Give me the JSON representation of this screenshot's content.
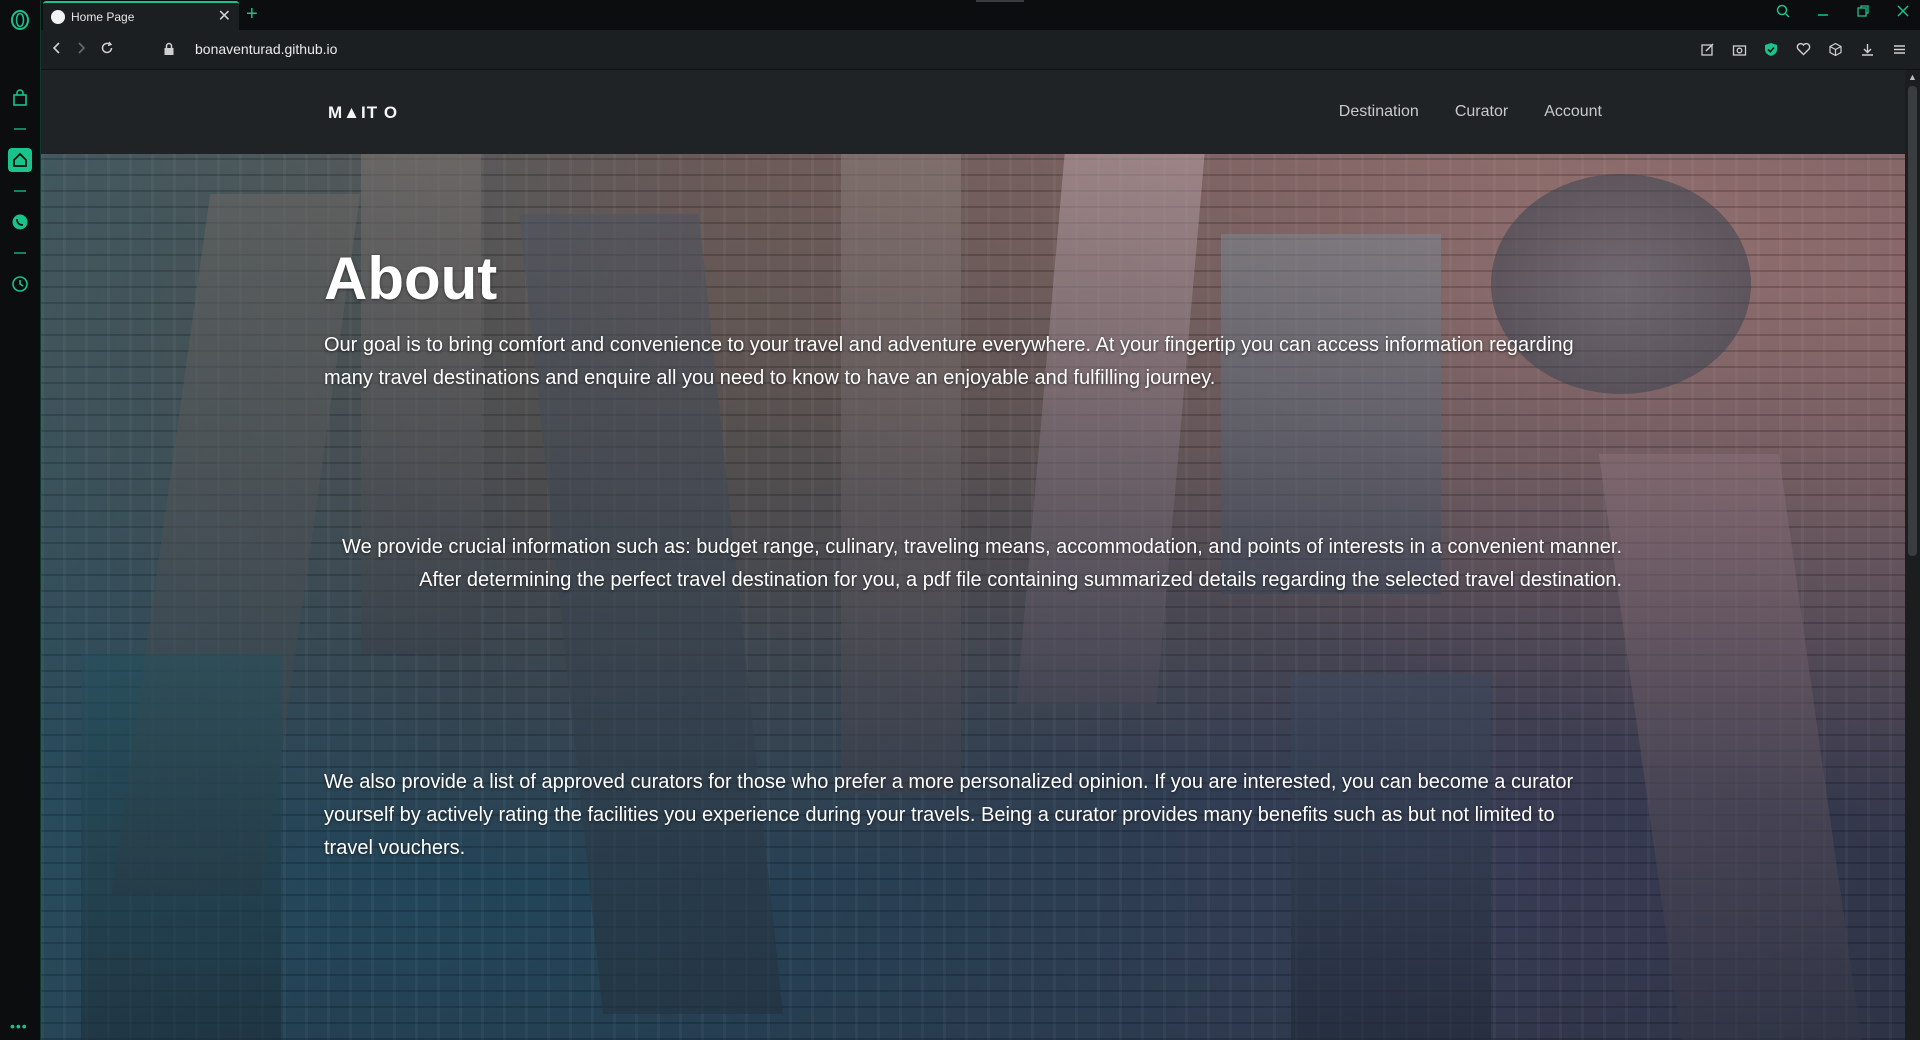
{
  "browser": {
    "tab": {
      "title": "Home Page",
      "close_symbol": "✕"
    },
    "new_tab_symbol": "+",
    "url": "bonaventurad.github.io",
    "accent_color": "#19c38a"
  },
  "site": {
    "logo": "M▲IT O",
    "nav": [
      "Destination",
      "Curator",
      "Account"
    ]
  },
  "about": {
    "title": "About",
    "paragraph1": "Our goal is to bring comfort and convenience to your travel and adventure everywhere. At your fingertip you can access information regarding many travel destinations and enquire all you need to know to have an enjoyable and fulfilling journey.",
    "paragraph2": "We provide crucial information such as: budget range, culinary, traveling means, accommodation, and points of interests in a convenient manner. After determining the perfect travel destination for you, a pdf file containing summarized details regarding the selected travel destination.",
    "paragraph3": "We also provide a list of approved curators for those who prefer a more personalized opinion. If you are interested, you can become a curator yourself by actively rating the facilities you experience during your travels. Being a curator provides many benefits such as but not limited to travel vouchers."
  },
  "icons": {
    "sidebar": [
      "opera-gx-logo-icon",
      "shopping-bag-icon",
      "home-icon",
      "whatsapp-icon",
      "clock-icon"
    ],
    "toolbar": [
      "edit-icon",
      "camera-icon",
      "shield-icon",
      "heart-icon",
      "cube-icon",
      "download-icon",
      "menu-icon"
    ],
    "window": [
      "search-icon",
      "minimize-icon",
      "restore-icon",
      "close-icon"
    ]
  }
}
